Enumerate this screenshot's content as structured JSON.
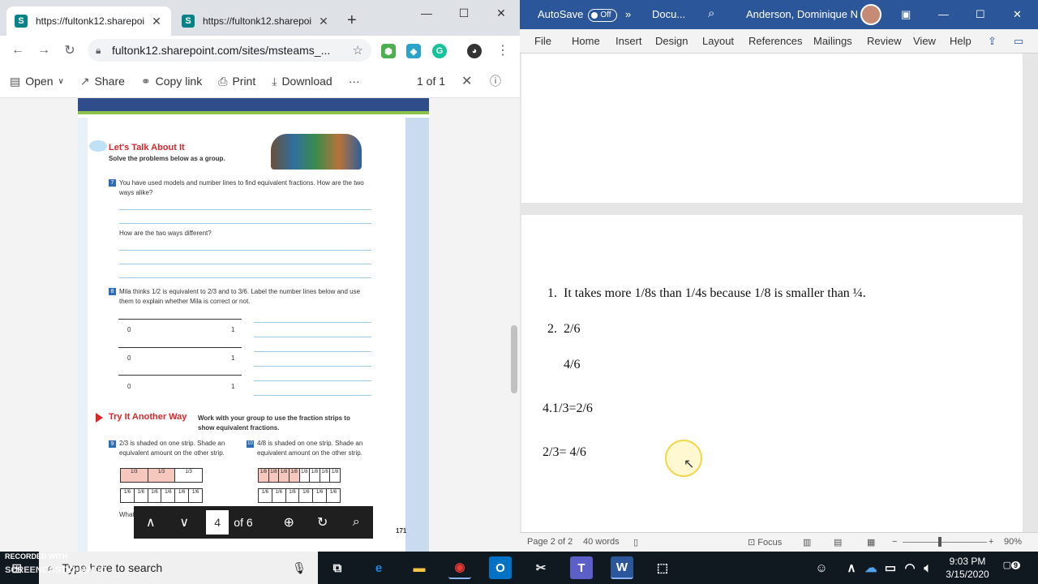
{
  "browser": {
    "tabs": [
      {
        "title": "https://fultonk12.sharepoi",
        "favicon": "S"
      },
      {
        "title": "https://fultonk12.sharepoi",
        "favicon": "S"
      }
    ],
    "new_tab": "+",
    "url": "fultonk12.sharepoint.com/sites/msteams_...",
    "commands": {
      "open": "Open",
      "share": "Share",
      "copy_link": "Copy link",
      "print": "Print",
      "download": "Download",
      "more": "···",
      "page_count": "1 of 1"
    },
    "pdf": {
      "lets_talk": "Let's Talk About It",
      "lets_talk_sub": "Solve the problems below as a group.",
      "q7": "You have used models and number lines to find equivalent fractions. How are the two ways alike?",
      "q7b": "How are the two ways different?",
      "q8": "Mila thinks 1/2 is equivalent to 2/3 and to 3/6. Label the number lines below and use them to explain whether Mila is correct or not.",
      "nl_zero": "0",
      "nl_one": "1",
      "try_another": "Try It Another Way",
      "try_sub": "Work with your group to use the fraction strips to show equivalent fractions.",
      "q9": "2/3 is shaded on one strip. Shade an equivalent amount on the other strip.",
      "q10": "4/8 is shaded on one strip. Shade an equivalent amount on the other strip.",
      "strip_third": [
        "1/3",
        "1/3",
        "1/3"
      ],
      "strip_sixth": [
        "1/6",
        "1/6",
        "1/6",
        "1/6",
        "1/6",
        "1/6"
      ],
      "strip_eighth": [
        "1/8",
        "1/8",
        "1/8",
        "1/8",
        "1/8",
        "1/8",
        "1/8",
        "1/8"
      ],
      "what_fraction": "What fraction did you shade?",
      "page_number": "171"
    },
    "pdfnav": {
      "current_page": "4",
      "of_pages": "of 6"
    }
  },
  "word": {
    "autosave_label": "AutoSave",
    "autosave_state": "Off",
    "doc_title": "Docu...",
    "user_name": "Anderson, Dominique N",
    "menu": [
      "File",
      "Home",
      "Insert",
      "Design",
      "Layout",
      "References",
      "Mailings",
      "Review",
      "View",
      "Help"
    ],
    "lines": {
      "l1_num": "1.",
      "l1_text": "It takes more 1/8s than 1/4s because 1/8 is smaller than ¼.",
      "l2_num": "2.",
      "l2_text": "2/6",
      "l3_text": "4/6",
      "l4_text": "4.1/3=2/6",
      "l5_text": "2/3= 4/6"
    },
    "status": {
      "page": "Page 2 of 2",
      "words": "40 words",
      "focus": "Focus",
      "zoom": "90%"
    }
  },
  "taskbar": {
    "search_placeholder": "Type here to search",
    "time": "9:03 PM",
    "date": "3/15/2020",
    "notifications": "9",
    "recorded_with": "RECORDED WITH",
    "screencast": "SCREENCAST-O-MATIC"
  },
  "colors": {
    "word_blue": "#2b579a",
    "sharepoint_teal": "#038387",
    "heading_red": "#d9262b"
  }
}
